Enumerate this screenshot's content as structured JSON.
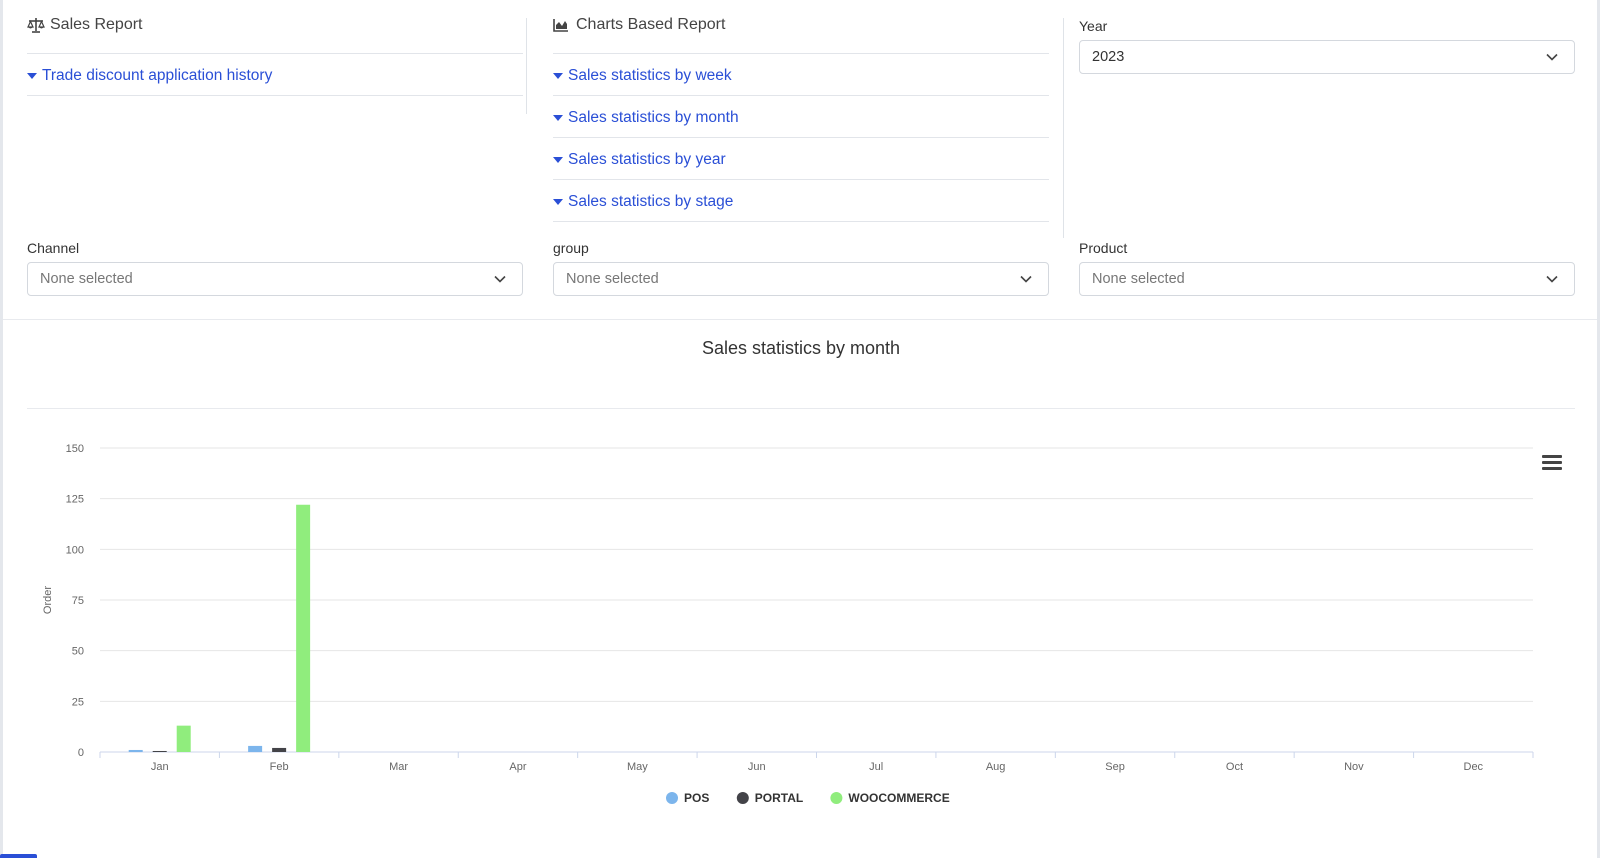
{
  "sales_report": {
    "title": "Sales Report",
    "links": [
      {
        "label": "Trade discount application history"
      }
    ]
  },
  "charts_report": {
    "title": "Charts Based Report",
    "links": [
      {
        "label": "Sales statistics by week"
      },
      {
        "label": "Sales statistics by month"
      },
      {
        "label": "Sales statistics by year"
      },
      {
        "label": "Sales statistics by stage"
      }
    ]
  },
  "year": {
    "label": "Year",
    "value": "2023"
  },
  "filters": {
    "channel": {
      "label": "Channel",
      "value": "None selected"
    },
    "group": {
      "label": "group",
      "value": "None selected"
    },
    "product": {
      "label": "Product",
      "value": "None selected"
    }
  },
  "icons": {
    "sales_report": "balance-scale-icon",
    "charts_report": "area-chart-icon",
    "caret": "caret-down-icon",
    "select": "chevron-down-icon",
    "chart_menu": "hamburger-menu-icon"
  },
  "chart_data": {
    "type": "bar",
    "title": "Sales statistics by month",
    "xlabel": "",
    "ylabel": "Order",
    "ylim": [
      0,
      150
    ],
    "yticks": [
      0,
      25,
      50,
      75,
      100,
      125,
      150
    ],
    "grid": true,
    "legend_position": "bottom-center",
    "categories": [
      "Jan",
      "Feb",
      "Mar",
      "Apr",
      "May",
      "Jun",
      "Jul",
      "Aug",
      "Sep",
      "Oct",
      "Nov",
      "Dec"
    ],
    "series": [
      {
        "name": "POS",
        "color": "#7cb5ec",
        "values": [
          1,
          3,
          0,
          0,
          0,
          0,
          0,
          0,
          0,
          0,
          0,
          0
        ]
      },
      {
        "name": "PORTAL",
        "color": "#434348",
        "values": [
          0.5,
          2,
          0,
          0,
          0,
          0,
          0,
          0,
          0,
          0,
          0,
          0
        ]
      },
      {
        "name": "WOOCOMMERCE",
        "color": "#90ed7d",
        "values": [
          13,
          122,
          0,
          0,
          0,
          0,
          0,
          0,
          0,
          0,
          0,
          0
        ]
      }
    ]
  },
  "colors": {
    "link": "#2a4fd6",
    "border": "#d4d8de",
    "divider": "#e2e5ea"
  }
}
